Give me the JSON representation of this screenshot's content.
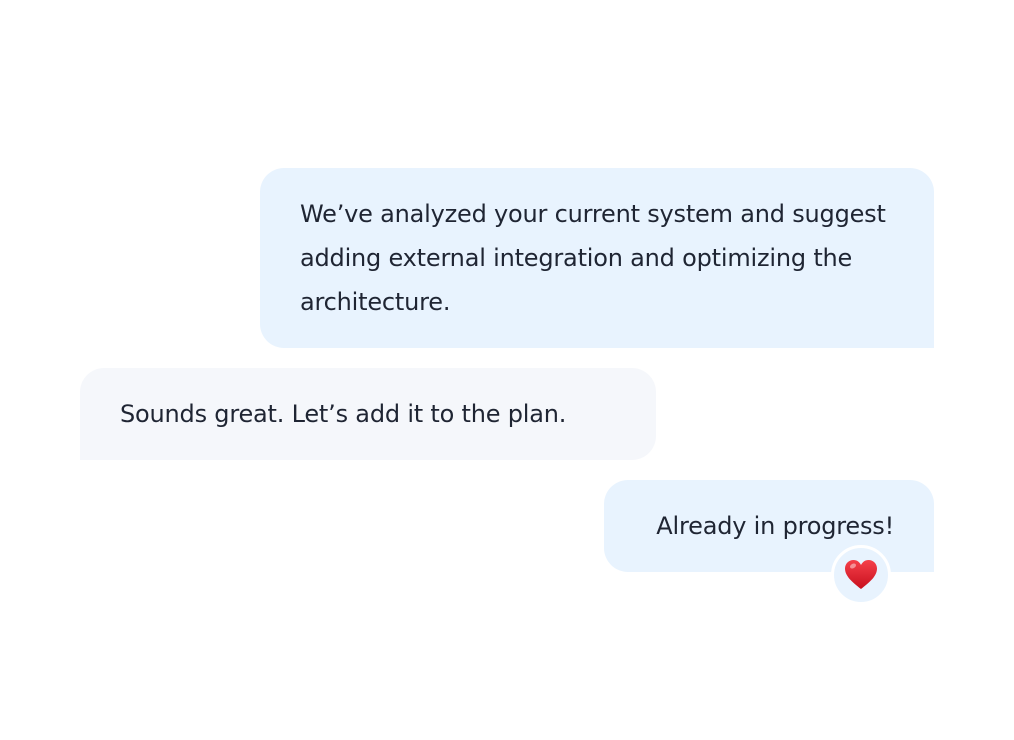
{
  "conversation": {
    "messages": [
      {
        "direction": "outgoing",
        "text": "We’ve analyzed your current system and suggest adding external integration and optimizing the architecture."
      },
      {
        "direction": "incoming",
        "text": "Sounds great. Let’s add it to the plan."
      },
      {
        "direction": "outgoing",
        "text": "Already in progress!",
        "reaction": {
          "icon": "heart-icon",
          "color": "#e8202e"
        }
      }
    ]
  },
  "colors": {
    "outgoing_bubble": "#e8f3fe",
    "incoming_bubble": "#f5f7fb",
    "text": "#1f2533",
    "background": "#ffffff"
  }
}
